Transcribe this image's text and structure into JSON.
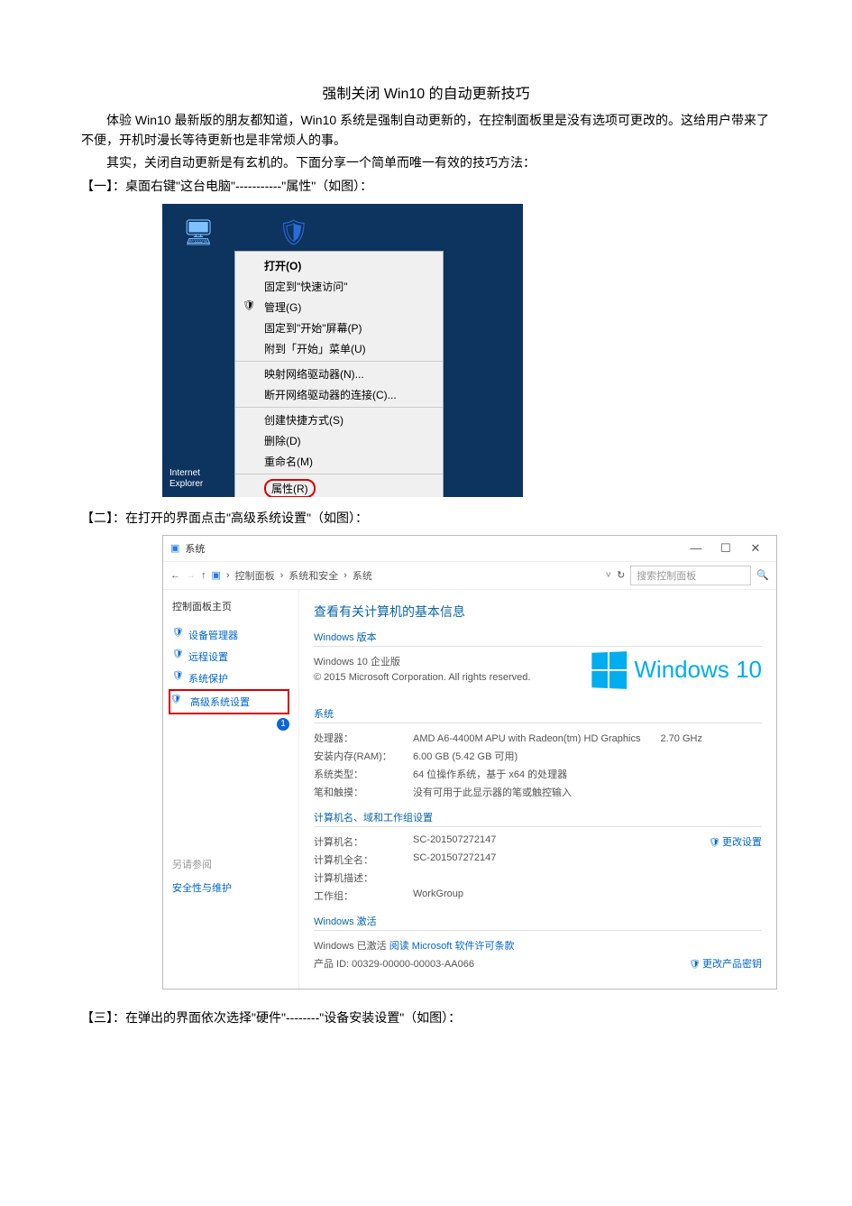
{
  "doc": {
    "title": "强制关闭 Win10 的自动更新技巧",
    "p1": "体验 Win10 最新版的朋友都知道，Win10 系统是强制自动更新的，在控制面板里是没有选项可更改的。这给用户带来了不便，开机时漫长等待更新也是非常烦人的事。",
    "p2": "其实，关闭自动更新是有玄机的。下面分享一个简单而唯一有效的技巧方法：",
    "step1": "【一】：桌面右键\"这台电脑\"-----------\"属性\"（如图）：",
    "step2": "【二】：在打开的界面点击\"高级系统设置\"（如图）：",
    "step3": "【三】：在弹出的界面依次选择\"硬件\"--------\"设备安装设置\"（如图）："
  },
  "context_menu": {
    "open": "打开(O)",
    "pin_quick": "固定到\"快速访问\"",
    "manage": "管理(G)",
    "pin_start": "固定到\"开始\"屏幕(P)",
    "attach_start": "附到「开始」菜单(U)",
    "map_drive": "映射网络驱动器(N)...",
    "disconnect_drive": "断开网络驱动器的连接(C)...",
    "create_shortcut": "创建快捷方式(S)",
    "delete": "删除(D)",
    "rename": "重命名(M)",
    "properties": "属性(R)"
  },
  "ie_label": "Internet\nExplorer",
  "sys_window": {
    "title": "系统",
    "crumb1": "控制面板",
    "crumb2": "系统和安全",
    "crumb3": "系统",
    "search_ph": "搜索控制面板",
    "sidebar": {
      "home": "控制面板主页",
      "device_mgr": "设备管理器",
      "remote": "远程设置",
      "protect": "系统保护",
      "advanced": "高级系统设置",
      "see_also": "另请参阅",
      "security": "安全性与维护"
    },
    "heading": "查看有关计算机的基本信息",
    "winver_sect": "Windows 版本",
    "winver": "Windows 10 企业版",
    "copyright": "© 2015 Microsoft Corporation. All rights reserved.",
    "wintext": "Windows 10",
    "sys_sect": "系统",
    "cpu_k": "处理器：",
    "cpu_v": "AMD A6-4400M APU with Radeon(tm) HD Graphics　　2.70 GHz",
    "ram_k": "安装内存(RAM)：",
    "ram_v": "6.00 GB (5.42 GB 可用)",
    "type_k": "系统类型：",
    "type_v": "64 位操作系统，基于 x64 的处理器",
    "pen_k": "笔和触摸：",
    "pen_v": "没有可用于此显示器的笔或触控输入",
    "name_sect": "计算机名、域和工作组设置",
    "cname_k": "计算机名：",
    "cname_v": "SC-201507272147",
    "change": "更改设置",
    "cfull_k": "计算机全名：",
    "cfull_v": "SC-201507272147",
    "cdesc_k": "计算机描述：",
    "wg_k": "工作组：",
    "wg_v": "WorkGroup",
    "act_sect": "Windows 激活",
    "act_txt": "Windows 已激活  ",
    "act_link": "阅读 Microsoft 软件许可条款",
    "pid_k": "产品 ID: ",
    "pid_v": "00329-00000-00003-AA066",
    "change_pid": "更改产品密钥"
  }
}
